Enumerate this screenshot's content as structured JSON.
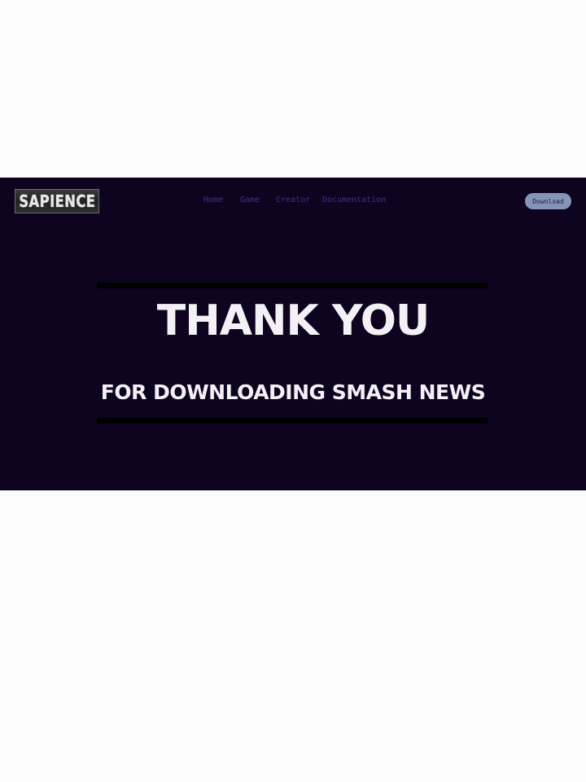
{
  "header": {
    "logo_text": "SAPIENCE",
    "nav": [
      {
        "label": "Home"
      },
      {
        "label": "Game"
      },
      {
        "label": "Creator"
      },
      {
        "label": "Documentation"
      }
    ],
    "download_label": "Download"
  },
  "hero": {
    "headline": "THANK YOU",
    "subline": "FOR DOWNLOADING SMASH NEWS"
  },
  "colors": {
    "page_background": "#fdfcfd",
    "panel_background": "#0e0420",
    "nav_link": "#4b2c86",
    "download_button": "#8595b9",
    "headline_text": "#f2f2f6",
    "rule": "#000000"
  }
}
